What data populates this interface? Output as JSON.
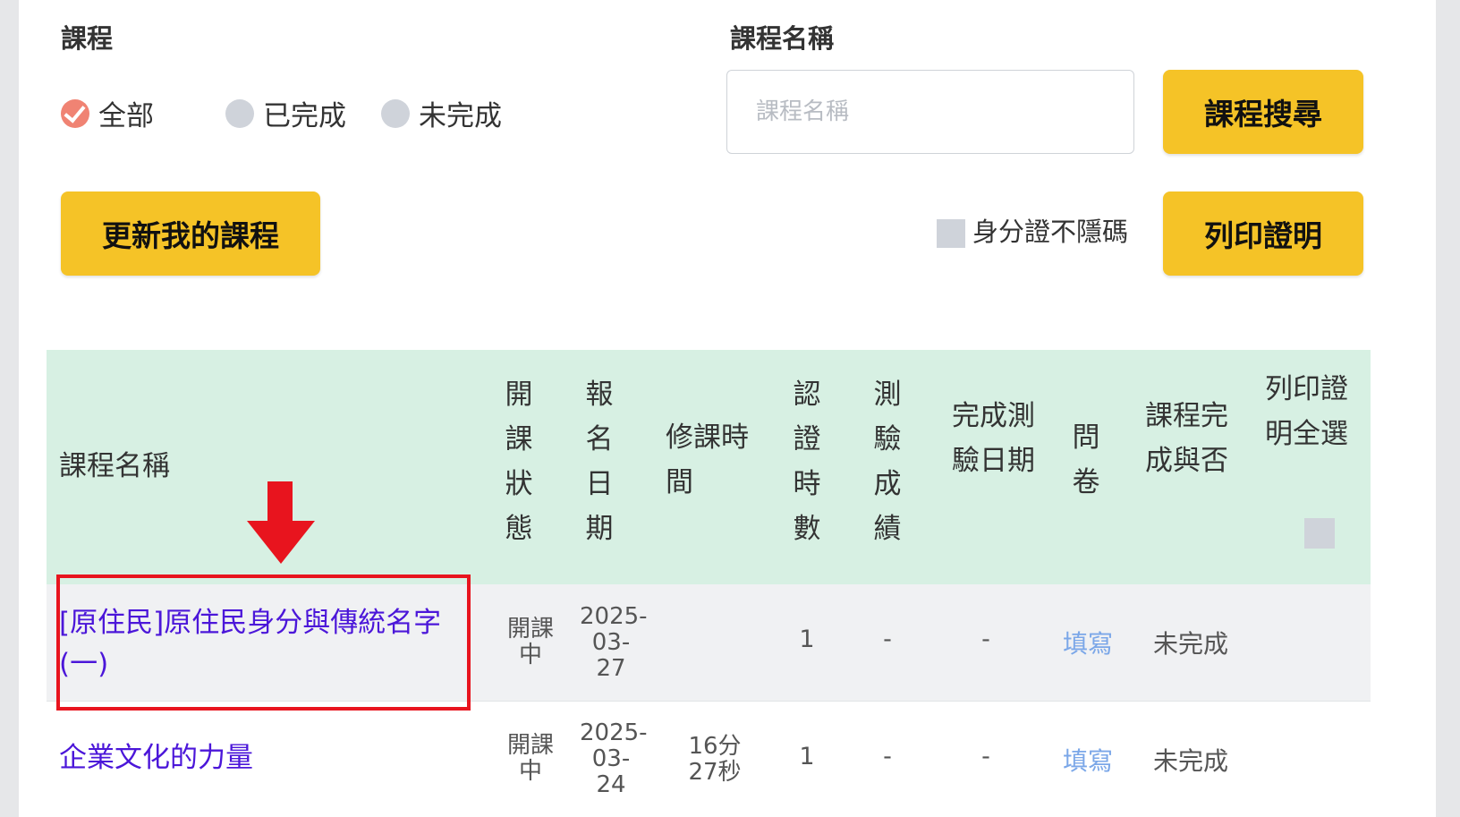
{
  "filters": {
    "course_label": "課程",
    "course_name_label": "課程名稱",
    "radios": [
      {
        "label": "全部",
        "checked": true
      },
      {
        "label": "已完成",
        "checked": false
      },
      {
        "label": "未完成",
        "checked": false
      }
    ],
    "search_placeholder": "課程名稱",
    "search_button": "課程搜尋",
    "refresh_button": "更新我的課程",
    "id_unmask_label": "身分證不隱碼",
    "print_button": "列印證明"
  },
  "table": {
    "headers": {
      "name": "課程名稱",
      "status": "開課狀態",
      "enroll_date": "報名日期",
      "study_time": "修課時間",
      "cert_hours": "認證時數",
      "test_score": "測驗成績",
      "test_date": "完成測驗日期",
      "survey": "問卷",
      "completion": "課程完成與否",
      "print_select_all": "列印證明全選"
    },
    "rows": [
      {
        "name": "[原住民]原住民身分與傳統名字(一)",
        "status": "開課中",
        "enroll_date": "2025-03-27",
        "study_time": "",
        "cert_hours": "1",
        "test_score": "-",
        "test_date": "-",
        "survey": "填寫",
        "completion": "未完成"
      },
      {
        "name": "企業文化的力量",
        "status": "開課中",
        "enroll_date": "2025-03-24",
        "study_time": "16分27秒",
        "cert_hours": "1",
        "test_score": "-",
        "test_date": "-",
        "survey": "填寫",
        "completion": "未完成"
      }
    ]
  },
  "annotation": {
    "color": "#e8141e"
  }
}
